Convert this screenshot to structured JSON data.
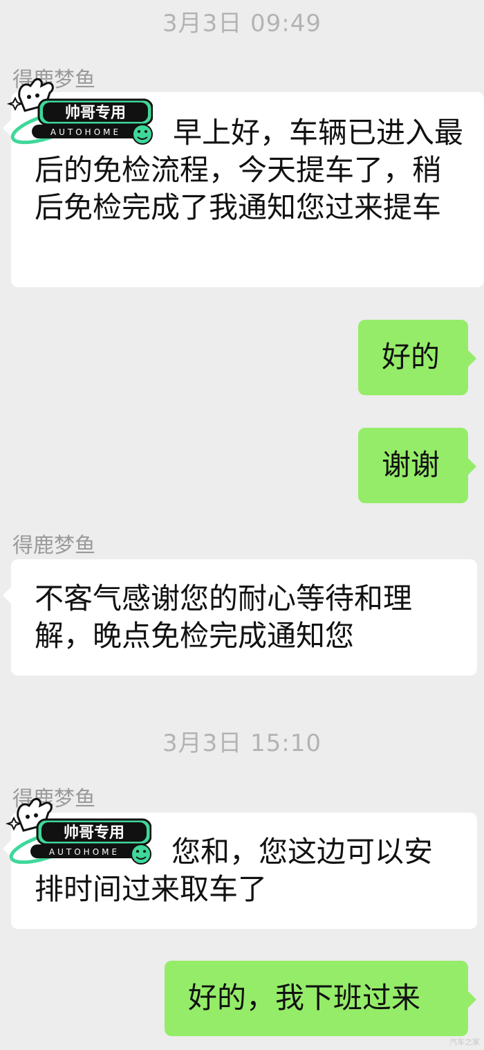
{
  "timestamps": [
    "3月3日 09:49",
    "3月3日 15:10"
  ],
  "messages": [
    {
      "sender": "得鹿梦鱼",
      "text": "早上好，车辆已进入最后的免检流程，今天提车了，稍后免检完成了我通知您过来提车"
    },
    {
      "text": "好的"
    },
    {
      "text": "谢谢"
    },
    {
      "sender": "得鹿梦鱼",
      "text": "不客气感谢您的耐心等待和理解，晚点免检完成通知您"
    },
    {
      "sender": "得鹿梦鱼",
      "text": "您和，您这边可以安排时间过来取车了"
    },
    {
      "text": "好的，我下班过来"
    }
  ],
  "sticker": {
    "title": "帅哥专用",
    "subtitle": "AUTOHOME"
  },
  "watermark": "汽车之家",
  "colors": {
    "background": "#ededed",
    "incoming": "#ffffff",
    "outgoing": "#95ec69",
    "sticker_green": "#3fd89a"
  }
}
